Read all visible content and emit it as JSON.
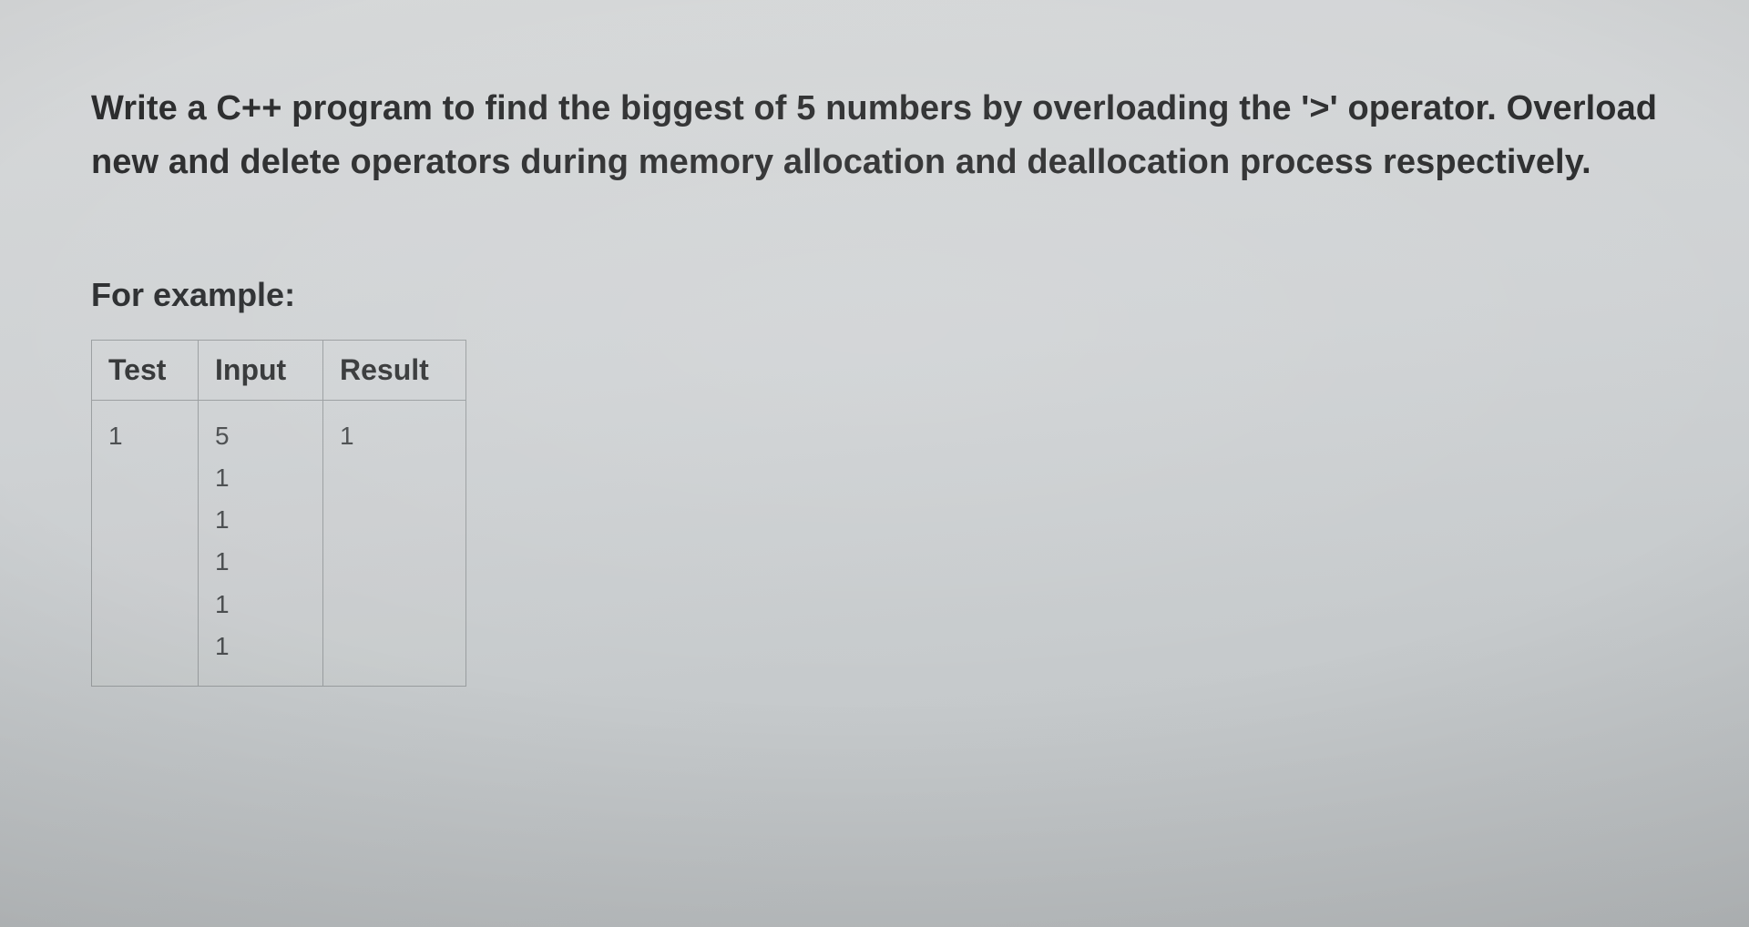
{
  "question_text": "Write a C++ program to find the biggest of 5 numbers by overloading the '>' operator. Overload new and delete operators during memory allocation and deallocation process respectively.",
  "example_label": "For example:",
  "table": {
    "headers": [
      "Test",
      "Input",
      "Result"
    ],
    "rows": [
      {
        "test": "1",
        "input": "5\n1\n1\n1\n1\n1",
        "result": "1"
      }
    ]
  }
}
